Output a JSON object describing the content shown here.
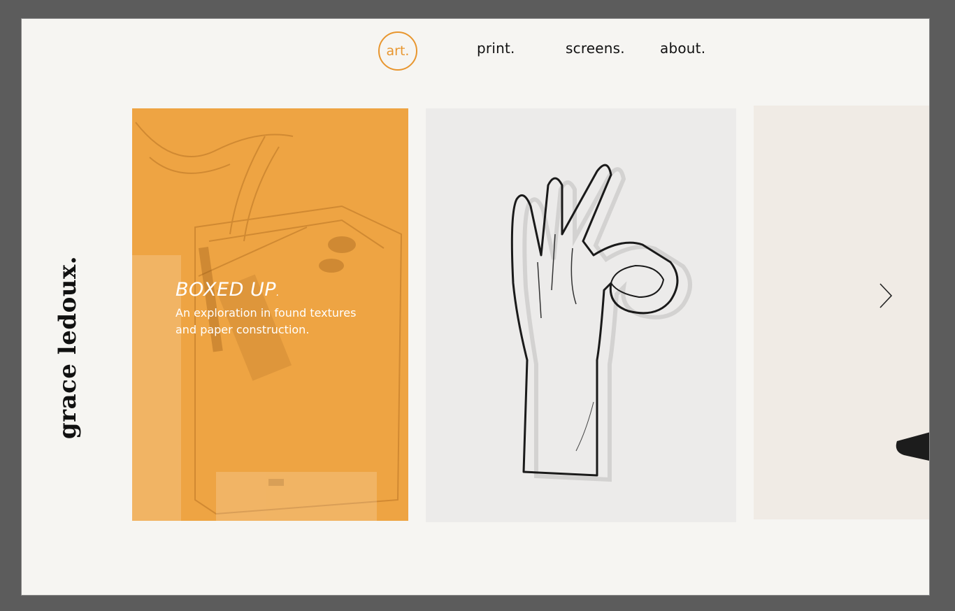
{
  "nav": {
    "active": "art.",
    "items": [
      "print.",
      "screens.",
      "about."
    ]
  },
  "logo": "grace ledoux.",
  "cards": [
    {
      "title": "BOXED UP",
      "title_suffix": ".",
      "description_line1": "An exploration in found textures",
      "description_line2": "and paper construction."
    }
  ],
  "icons": {
    "next": "chevron-right-icon",
    "active_nav_ring": "circle-outline"
  },
  "colors": {
    "accent": "#e8962f",
    "page_background": "#f6f5f2",
    "frame": "#5c5c5c",
    "text": "#111111"
  }
}
